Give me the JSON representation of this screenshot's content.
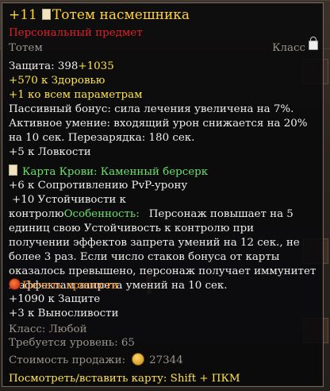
{
  "item": {
    "enhance": "+11",
    "name": "Тотем насмешника",
    "personal": "Персональный предмет",
    "type": "Тотем",
    "class_right": "Класс",
    "defense_label": "Защита: 398",
    "defense_bonus": "+1035",
    "hp_bonus": "+570 к Здоровью",
    "all_stats": "+1 ко всем параметрам",
    "passive": "Пассивный бонус: сила лечения увеличена на 7%.",
    "active": "Активное умение: входящий урон снижается на 20% на 10 сек. Перезарядка: 180 сек.",
    "agility": "+5 к Ловкости"
  },
  "card": {
    "name": "Карта Крови: Каменный берсерк",
    "pvp_res": "+6 к Сопротивлению PvP-урону",
    "cc_res": "+10 Устойчивости к контролю",
    "feature_label": "Особенность:",
    "feature_text": "Персонаж повышает на 5 единиц свою Устойчивость к контролю при получении эффектов запрета умений на 12 сек., не более 3 раз. Если число стаков бонуса от карты оказалось превышено, персонаж получает иммунитет к эффектам запрета умений на 10 сек."
  },
  "seal": {
    "name": "Печать крепости",
    "defense": "+1090 к Защите",
    "stamina": "+3 к Выносливости"
  },
  "footer": {
    "class_req": "Класс: Любой",
    "level_req": "Требуется уровень: 65",
    "price_label": "Стоимость продажи:",
    "price_value": "27344",
    "hint": "Посмотреть/вставить карту: Shift + ПКМ"
  },
  "colors": {
    "title": "#ffd23a",
    "personal": "#e0202a",
    "bonus": "#ffe24a",
    "card": "#6be06b",
    "seal": "#ff9a2a"
  },
  "icons": [
    "item-scroll-icon",
    "lock-icon",
    "card-icon",
    "seal-icon",
    "coin-icon"
  ]
}
